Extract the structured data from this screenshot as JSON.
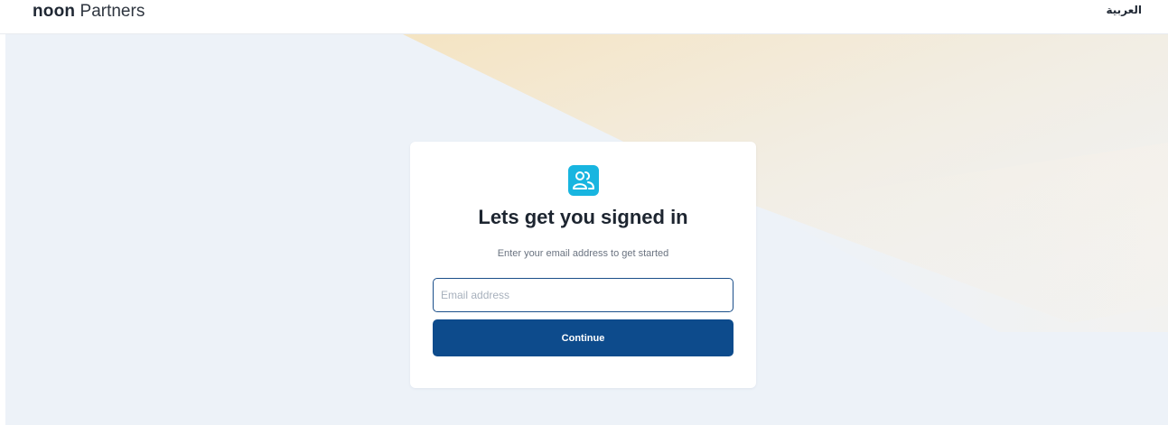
{
  "header": {
    "brand_bold": "noon",
    "brand_light": "Partners",
    "language_link": "العربية"
  },
  "signin": {
    "icon": "partners-users-icon",
    "title": "Lets get you signed in",
    "subtitle": "Enter your email address to get started",
    "email_placeholder": "Email address",
    "email_value": "",
    "continue_label": "Continue"
  },
  "colors": {
    "primary_button": "#0d4b8c",
    "input_border": "#1b4f8a",
    "icon_background": "#18b5e0",
    "hero_background": "#edf2f8",
    "hero_accent": "#f6e6c6"
  }
}
